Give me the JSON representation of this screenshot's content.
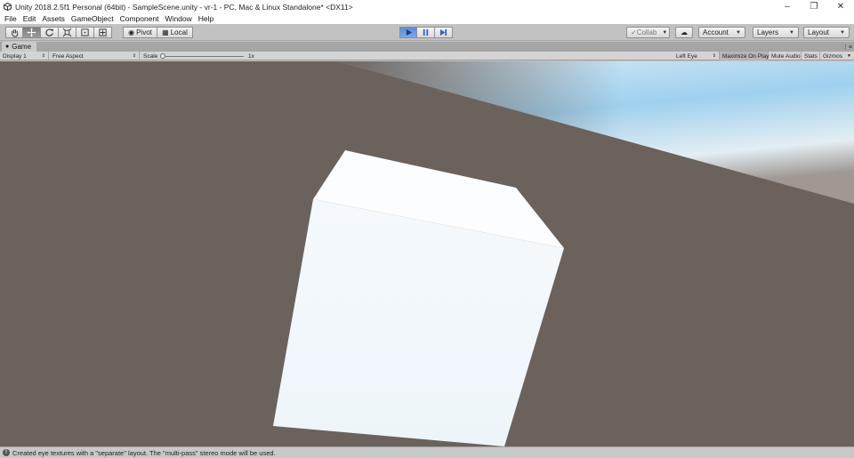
{
  "window": {
    "title": "Unity 2018.2.5f1 Personal (64bit) - SampleScene.unity - vr-1 - PC, Mac & Linux Standalone* <DX11>",
    "controls": [
      "minimize-icon",
      "maximize-icon",
      "close-icon"
    ]
  },
  "menu": [
    "File",
    "Edit",
    "Assets",
    "GameObject",
    "Component",
    "Window",
    "Help"
  ],
  "toolbar": {
    "tools": [
      "hand-tool-icon",
      "move-tool-icon",
      "rotate-tool-icon",
      "scale-tool-icon",
      "rect-tool-icon",
      "transform-tool-icon"
    ],
    "active_tool": "move-tool-icon",
    "pivot_label": "Pivot",
    "local_label": "Local",
    "playback": [
      "play-icon",
      "pause-icon",
      "step-icon"
    ],
    "play_state": "playing",
    "collab_label": "Collab",
    "account_label": "Account",
    "layers_label": "Layers",
    "layout_label": "Layout",
    "accent_color": "#4a7fd4"
  },
  "game_view": {
    "tab_label": "Game",
    "display": "Display 1",
    "aspect": "Free Aspect",
    "scale_label": "Scale",
    "scale_value": "1x",
    "eye": "Left Eye",
    "maximize_on_play": "Maximize On Play",
    "mute_audio": "Mute Audio",
    "stats": "Stats",
    "gizmos": "Gizmos",
    "background_color": "#6b625c",
    "object_color": "#f1f7fb"
  },
  "status": {
    "message": "Created eye textures with a \"separate\" layout.  The \"multi-pass\" stereo mode will be used."
  }
}
